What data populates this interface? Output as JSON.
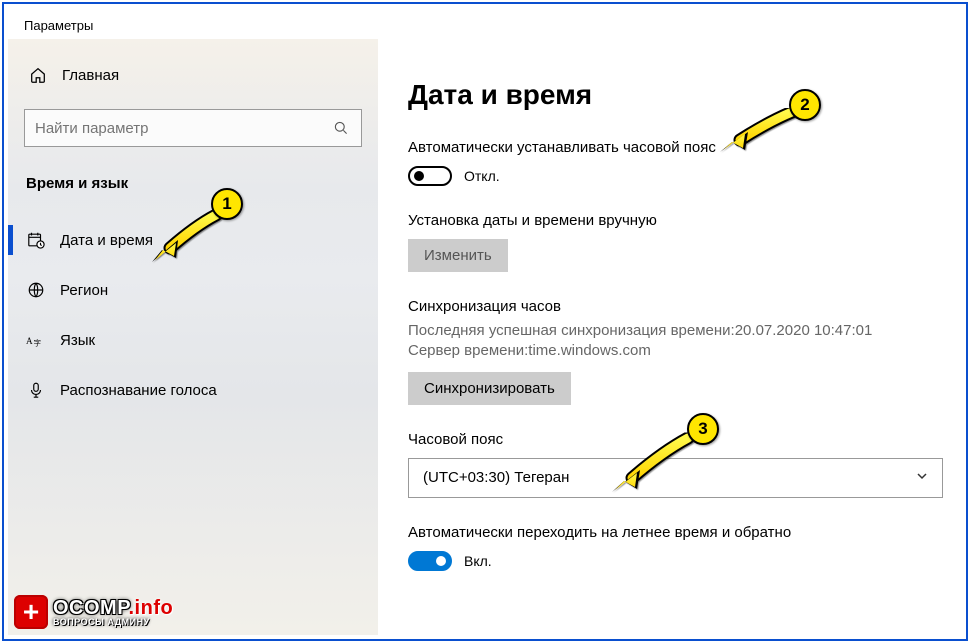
{
  "window_title": "Параметры",
  "sidebar": {
    "home": "Главная",
    "search_placeholder": "Найти параметр",
    "category": "Время и язык",
    "items": [
      {
        "label": "Дата и время"
      },
      {
        "label": "Регион"
      },
      {
        "label": "Язык"
      },
      {
        "label": "Распознавание голоса"
      }
    ]
  },
  "main": {
    "title": "Дата и время",
    "auto_tz_label": "Автоматически устанавливать часовой пояс",
    "auto_tz_state": "Откл.",
    "manual_label": "Установка даты и времени вручную",
    "change_button": "Изменить",
    "sync_title": "Синхронизация часов",
    "sync_last": "Последняя успешная синхронизация времени:20.07.2020 10:47:01",
    "sync_server": "Сервер времени:time.windows.com",
    "sync_button": "Синхронизировать",
    "tz_label": "Часовой пояс",
    "tz_value": "(UTC+03:30) Тегеран",
    "dst_label": "Автоматически переходить на летнее время и обратно",
    "dst_state": "Вкл."
  },
  "annotations": {
    "a1": "1",
    "a2": "2",
    "a3": "3"
  },
  "logo": {
    "main": "OCOMP",
    "suffix": ".info",
    "sub": "ВОПРОСЫ АДМИНУ"
  }
}
